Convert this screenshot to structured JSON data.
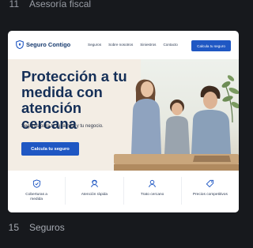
{
  "list": {
    "top": {
      "number": "11",
      "label": "Asesoría fiscal"
    },
    "bottom": {
      "number": "15",
      "label": "Seguros"
    }
  },
  "site": {
    "logo_text": "Seguro Contigo",
    "nav": [
      "Seguros",
      "Sobre nosotros",
      "Siniestros",
      "Contacto"
    ],
    "nav_cta": "Calcula tu seguro",
    "hero": {
      "title": "Protección a tu medida con atención cercana",
      "subtitle": "Seguros para ti, tu familia y tu negocio.",
      "cta": "Calcula tu seguro"
    },
    "features": [
      {
        "label": "Coberturas a medida",
        "icon": "shield-check-icon"
      },
      {
        "label": "Atención rápida",
        "icon": "headset-user-icon"
      },
      {
        "label": "Trato cercano",
        "icon": "person-icon"
      },
      {
        "label": "Precios competitivos",
        "icon": "price-tag-icon"
      }
    ]
  },
  "colors": {
    "brand_blue": "#1f57c3",
    "navy": "#152f57",
    "page_bg": "#17191d"
  }
}
